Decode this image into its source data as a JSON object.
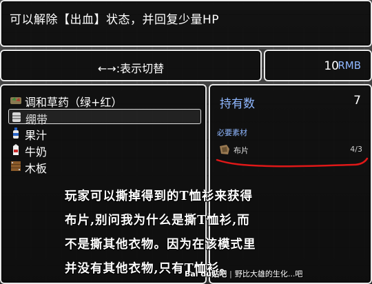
{
  "help": {
    "text": "可以解除【出血】状态，并回复少量HP"
  },
  "switch_hint": {
    "text": "←→:表示切替"
  },
  "money": {
    "value": "10",
    "unit": "RMB"
  },
  "items": [
    {
      "label": "调和草药（绿+红）",
      "icon": "herb-icon",
      "selected": false
    },
    {
      "label": "绷带",
      "icon": "bandage-icon",
      "selected": true
    },
    {
      "label": "果汁",
      "icon": "juice-bottle-icon",
      "selected": false
    },
    {
      "label": "牛奶",
      "icon": "milk-carton-icon",
      "selected": false
    },
    {
      "label": "木板",
      "icon": "wood-board-icon",
      "selected": false
    }
  ],
  "detail": {
    "owned_label": "持有数",
    "owned_count": "7",
    "material_header": "必要素材",
    "material": {
      "name": "布片",
      "progress": "4/3",
      "icon": "cloth-icon"
    }
  },
  "caption": {
    "lines": [
      "玩家可以撕掉得到的T恤衫来获得",
      "布片,别问我为什么是撕T恤衫,而",
      "不是撕其他衣物。因为在该模式里",
      "并没有其他衣物,只有T恤衫。"
    ]
  },
  "watermark": {
    "logo": "Bai du贴吧",
    "text": "野比大雄的生化...吧"
  },
  "colors": {
    "accent_blue": "#8fb7ff",
    "annotation_red": "#e01818"
  }
}
